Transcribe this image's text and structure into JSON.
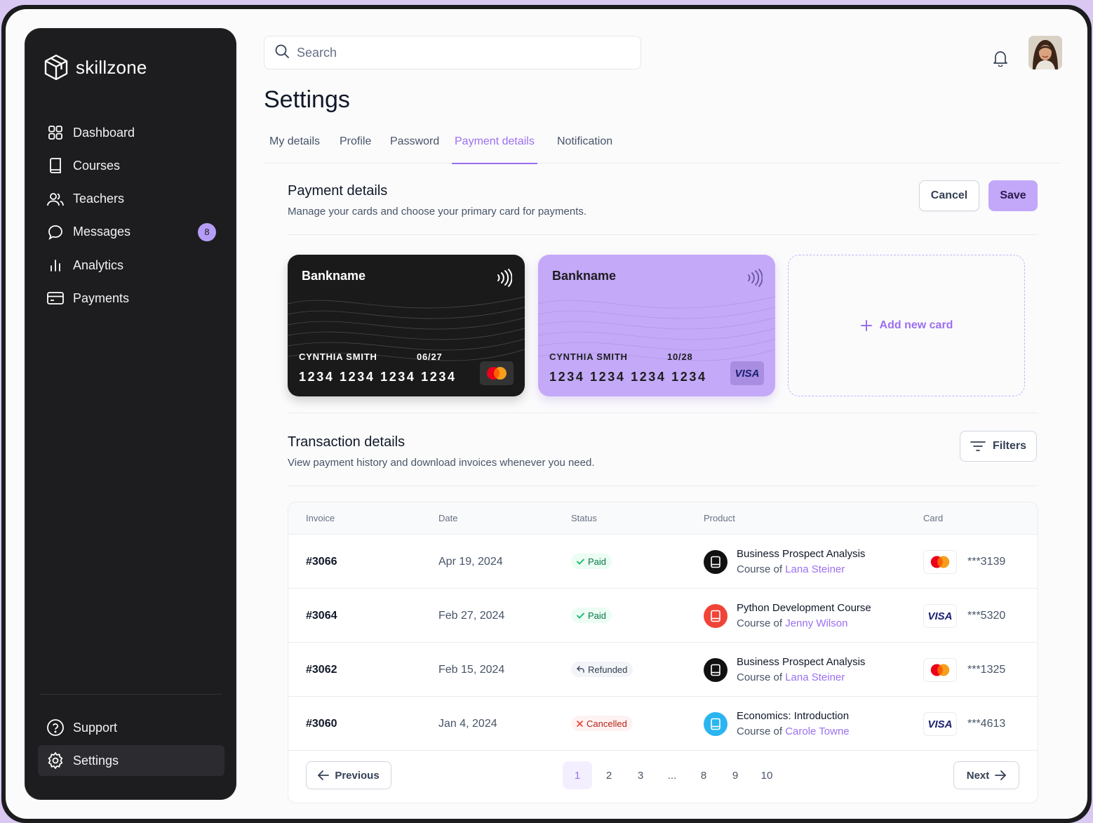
{
  "app": {
    "name": "skillzone"
  },
  "sidebar": {
    "items": [
      {
        "label": "Dashboard",
        "icon": "grid-icon"
      },
      {
        "label": "Courses",
        "icon": "book-icon"
      },
      {
        "label": "Teachers",
        "icon": "users-icon"
      },
      {
        "label": "Messages",
        "icon": "message-icon",
        "badge": "8"
      },
      {
        "label": "Analytics",
        "icon": "bar-chart-icon"
      },
      {
        "label": "Payments",
        "icon": "credit-card-icon"
      }
    ],
    "bottom": [
      {
        "label": "Support",
        "icon": "help-circle-icon"
      },
      {
        "label": "Settings",
        "icon": "gear-icon",
        "active": true
      }
    ]
  },
  "search": {
    "placeholder": "Search"
  },
  "page": {
    "title": "Settings"
  },
  "tabs": [
    {
      "label": "My details"
    },
    {
      "label": "Profile"
    },
    {
      "label": "Password"
    },
    {
      "label": "Payment details",
      "active": true
    },
    {
      "label": "Notification"
    }
  ],
  "payment": {
    "title": "Payment details",
    "subtitle": "Manage your cards and choose your primary card for payments.",
    "cancel_label": "Cancel",
    "save_label": "Save",
    "cards": [
      {
        "bank": "Bankname",
        "holder": "CYNTHIA SMITH",
        "expiry": "06/27",
        "number": "1234 1234 1234 1234",
        "brand": "mastercard"
      },
      {
        "bank": "Bankname",
        "holder": "CYNTHIA SMITH",
        "expiry": "10/28",
        "number": "1234 1234 1234 1234",
        "brand": "VISA"
      }
    ],
    "add_card_label": "Add new card"
  },
  "transactions": {
    "title": "Transaction details",
    "subtitle": "View payment history and download invoices whenever you need.",
    "filters_label": "Filters",
    "columns": [
      "Invoice",
      "Date",
      "Status",
      "Product",
      "Card"
    ],
    "rows": [
      {
        "invoice": "#3066",
        "date": "Apr 19, 2024",
        "status": "Paid",
        "product": "Business Prospect Analysis",
        "course_of": "Course of ",
        "author": "Lana Steiner",
        "card_brand": "mastercard",
        "last4": "***3139"
      },
      {
        "invoice": "#3064",
        "date": "Feb 27, 2024",
        "status": "Paid",
        "product": "Python Development Course",
        "course_of": "Course of ",
        "author": "Jenny Wilson",
        "card_brand": "VISA",
        "last4": "***5320"
      },
      {
        "invoice": "#3062",
        "date": "Feb 15, 2024",
        "status": "Refunded",
        "product": "Business Prospect Analysis",
        "course_of": "Course of ",
        "author": "Lana Steiner",
        "card_brand": "mastercard",
        "last4": "***1325"
      },
      {
        "invoice": "#3060",
        "date": "Jan 4, 2024",
        "status": "Cancelled",
        "product": "Economics: Introduction",
        "course_of": "Course of ",
        "author": "Carole Towne",
        "card_brand": "VISA",
        "last4": "***4613"
      }
    ],
    "pagination": {
      "previous_label": "Previous",
      "next_label": "Next",
      "pages": [
        "1",
        "2",
        "3",
        "...",
        "8",
        "9",
        "10"
      ],
      "current": "1"
    }
  },
  "colors": {
    "accent": "#9b6ff0",
    "sidebar": "#1d1d1f",
    "card_purple": "#c4a9f8",
    "paid": "#067647",
    "cancelled": "#b42318"
  }
}
